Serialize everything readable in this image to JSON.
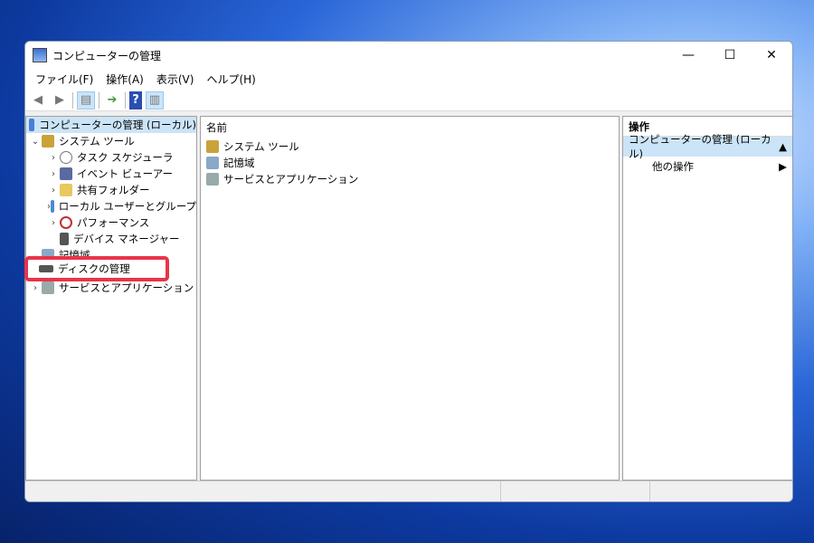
{
  "window": {
    "title": "コンピューターの管理"
  },
  "controls": {
    "minimize": "—",
    "maximize": "☐",
    "close": "✕"
  },
  "menu": [
    "ファイル(F)",
    "操作(A)",
    "表示(V)",
    "ヘルプ(H)"
  ],
  "tree": {
    "root": "コンピューターの管理 (ローカル)",
    "system_tools": "システム ツール",
    "children": [
      "タスク スケジューラ",
      "イベント ビューアー",
      "共有フォルダー",
      "ローカル ユーザーとグループ",
      "パフォーマンス",
      "デバイス マネージャー"
    ],
    "storage": "記憶域",
    "disk_management": "ディスクの管理",
    "services": "サービスとアプリケーション"
  },
  "middle": {
    "header": "名前",
    "items": [
      "システム ツール",
      "記憶域",
      "サービスとアプリケーション"
    ]
  },
  "actions": {
    "header": "操作",
    "selected": "コンピューターの管理 (ローカル)",
    "more": "他の操作"
  }
}
